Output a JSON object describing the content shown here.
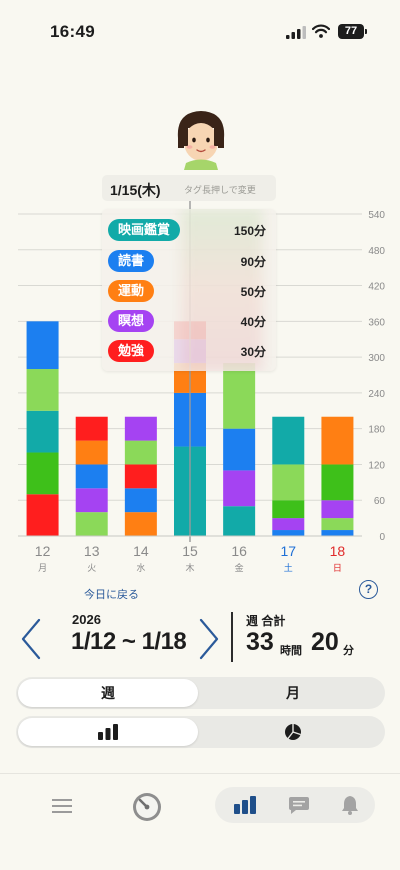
{
  "status_bar": {
    "time": "16:49",
    "battery": "77"
  },
  "colors": {
    "movie": "#12aaa8",
    "reading": "#1c7ff0",
    "exercise": "#ff7f13",
    "meditation": "#a543f2",
    "study": "#ff1e1e",
    "green": "#3ec01a",
    "light_green": "#8bd959",
    "today_line": "#9a9a9a",
    "saturday": "#1e6fd6",
    "sunday": "#e02a2a"
  },
  "tooltip": {
    "date": "1/15(木)",
    "hint": "タグ長押しで変更",
    "items": [
      {
        "label": "映画鑑賞",
        "minutes": "150分",
        "color": "#12aaa8"
      },
      {
        "label": "読書",
        "minutes": "90分",
        "color": "#1c7ff0"
      },
      {
        "label": "運動",
        "minutes": "50分",
        "color": "#ff7f13"
      },
      {
        "label": "瞑想",
        "minutes": "40分",
        "color": "#a543f2"
      },
      {
        "label": "勉強",
        "minutes": "30分",
        "color": "#ff1e1e"
      }
    ]
  },
  "chart_data": {
    "type": "bar",
    "stacked": true,
    "y_unit": "minutes",
    "ylim": [
      0,
      540
    ],
    "yticks": [
      "540",
      "480",
      "420",
      "360",
      "300",
      "240",
      "180",
      "120",
      "60",
      "0"
    ],
    "y_axis_position": "right",
    "grid": true,
    "days": [
      {
        "date": "12",
        "weekday": "月",
        "kind": "weekday",
        "segments": [
          {
            "color": "#ff1e1e",
            "value": 70
          },
          {
            "color": "#3ec01a",
            "value": 70
          },
          {
            "color": "#12aaa8",
            "value": 70
          },
          {
            "color": "#8bd959",
            "value": 70
          },
          {
            "color": "#1c7ff0",
            "value": 80
          }
        ]
      },
      {
        "date": "13",
        "weekday": "火",
        "kind": "weekday",
        "segments": [
          {
            "color": "#8bd959",
            "value": 40
          },
          {
            "color": "#a543f2",
            "value": 40
          },
          {
            "color": "#1c7ff0",
            "value": 40
          },
          {
            "color": "#ff7f13",
            "value": 40
          },
          {
            "color": "#ff1e1e",
            "value": 40
          }
        ]
      },
      {
        "date": "14",
        "weekday": "水",
        "kind": "weekday",
        "segments": [
          {
            "color": "#ff7f13",
            "value": 40
          },
          {
            "color": "#1c7ff0",
            "value": 40
          },
          {
            "color": "#ff1e1e",
            "value": 40
          },
          {
            "color": "#8bd959",
            "value": 40
          },
          {
            "color": "#a543f2",
            "value": 40
          }
        ]
      },
      {
        "date": "15",
        "weekday": "木",
        "kind": "weekday",
        "segments": [
          {
            "color": "#12aaa8",
            "value": 150
          },
          {
            "color": "#1c7ff0",
            "value": 90
          },
          {
            "color": "#ff7f13",
            "value": 50
          },
          {
            "color": "#a543f2",
            "value": 40
          },
          {
            "color": "#ff1e1e",
            "value": 30
          }
        ]
      },
      {
        "date": "16",
        "weekday": "金",
        "kind": "weekday",
        "segments": [
          {
            "color": "#12aaa8",
            "value": 50
          },
          {
            "color": "#a543f2",
            "value": 60
          },
          {
            "color": "#1c7ff0",
            "value": 70
          },
          {
            "color": "#8bd959",
            "value": 110
          }
        ]
      },
      {
        "date": "17",
        "weekday": "土",
        "kind": "saturday",
        "segments": [
          {
            "color": "#1c7ff0",
            "value": 10
          },
          {
            "color": "#a543f2",
            "value": 20
          },
          {
            "color": "#3ec01a",
            "value": 30
          },
          {
            "color": "#8bd959",
            "value": 60
          },
          {
            "color": "#12aaa8",
            "value": 80
          }
        ]
      },
      {
        "date": "18",
        "weekday": "日",
        "kind": "sunday",
        "segments": [
          {
            "color": "#1c7ff0",
            "value": 10
          },
          {
            "color": "#8bd959",
            "value": 20
          },
          {
            "color": "#a543f2",
            "value": 30
          },
          {
            "color": "#3ec01a",
            "value": 60
          },
          {
            "color": "#ff7f13",
            "value": 80
          }
        ]
      }
    ],
    "highlighted_day": "15"
  },
  "today_link": "今日に戻る",
  "help_icon": "?",
  "period": {
    "year": "2026",
    "range": "1/12 ~ 1/18",
    "total_label": "週 合計",
    "hours": "33",
    "hours_unit": "時間",
    "minutes": "20",
    "minutes_unit": "分"
  },
  "view_toggle": {
    "week": "週",
    "month": "月",
    "selected": "week"
  },
  "chart_toggle": {
    "bar_icon": "bar-chart-icon",
    "pie_icon": "pie-chart-icon",
    "selected": "bar"
  },
  "bottom_nav": {
    "menu_icon": "menu-icon",
    "gauge_icon": "gauge-icon",
    "chart_icon": "bar-chart-icon",
    "chat_icon": "chat-icon",
    "bell_icon": "bell-icon"
  }
}
